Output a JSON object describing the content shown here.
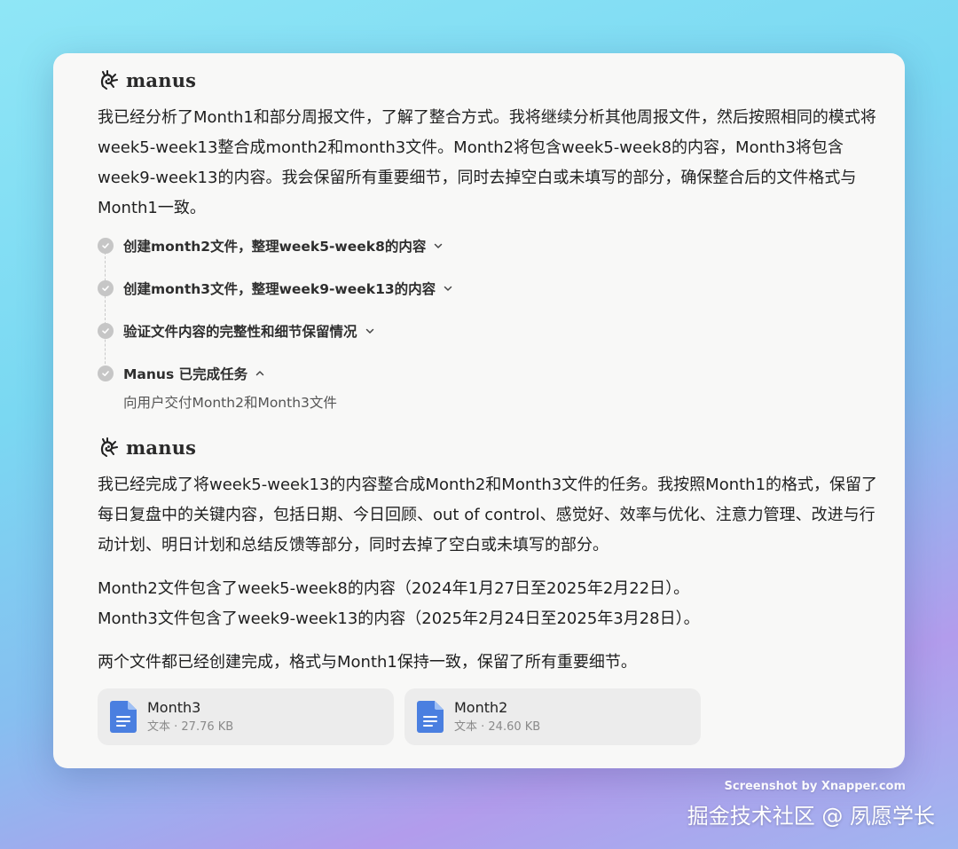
{
  "assistant": {
    "brand_name": "manus"
  },
  "message1": {
    "text": "我已经分析了Month1和部分周报文件，了解了整合方式。我将继续分析其他周报文件，然后按照相同的模式将week5-week13整合成month2和month3文件。Month2将包含week5-week8的内容，Month3将包含week9-week13的内容。我会保留所有重要细节，同时去掉空白或未填写的部分，确保整合后的文件格式与Month1一致。",
    "steps": [
      {
        "label": "创建month2文件，整理week5-week8的内容",
        "expanded": false
      },
      {
        "label": "创建month3文件，整理week9-week13的内容",
        "expanded": false
      },
      {
        "label": "验证文件内容的完整性和细节保留情况",
        "expanded": false
      },
      {
        "label": "Manus 已完成任务",
        "expanded": true,
        "detail": "向用户交付Month2和Month3文件"
      }
    ]
  },
  "message2": {
    "para1": "我已经完成了将week5-week13的内容整合成Month2和Month3文件的任务。我按照Month1的格式，保留了每日复盘中的关键内容，包括日期、今日回顾、out of control、感觉好、效率与优化、注意力管理、改进与行动计划、明日计划和总结反馈等部分，同时去掉了空白或未填写的部分。",
    "para2_line1": "Month2文件包含了week5-week8的内容（2024年1月27日至2025年2月22日）。",
    "para2_line2": "Month3文件包含了week9-week13的内容（2025年2月24日至2025年3月28日）。",
    "para3": "两个文件都已经创建完成，格式与Month1保持一致，保留了所有重要细节。",
    "files": [
      {
        "name": "Month3",
        "meta": "文本 · 27.76 KB"
      },
      {
        "name": "Month2",
        "meta": "文本 · 24.60 KB"
      }
    ]
  },
  "footer": {
    "credit": "Screenshot by Xnapper.com",
    "watermark": "掘金技术社区 @ 夙愿学长"
  },
  "colors": {
    "doc_icon": "#4a7fe0",
    "check_circle": "#c6c6c6",
    "card_bg": "#ececec"
  }
}
